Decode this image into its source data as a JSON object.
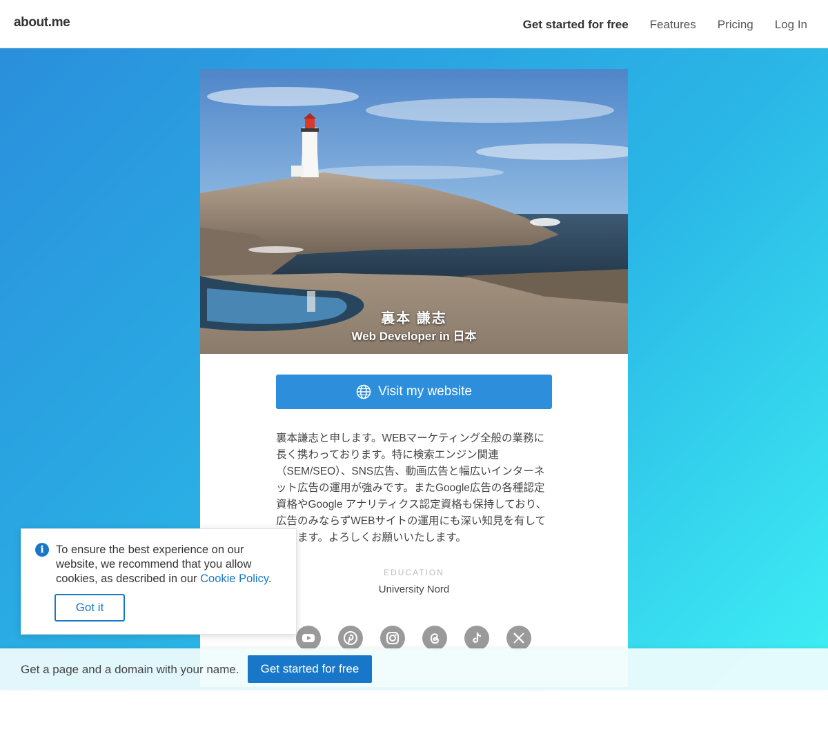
{
  "header": {
    "brand": "about.me",
    "nav": {
      "get_started": "Get started for free",
      "features": "Features",
      "pricing": "Pricing",
      "login": "Log In"
    }
  },
  "profile": {
    "name": "裏本 謙志",
    "headline": "Web Developer in 日本",
    "cover_image": "lighthouse-on-rocky-coast",
    "visit_button": "Visit my website",
    "bio": "裏本謙志と申します。WEBマーケティング全般の業務に長く携わっております。特に検索エンジン関連（SEM/SEO）、SNS広告、動画広告と幅広いインターネット広告の運用が強みです。またGoogle広告の各種認定資格やGoogle アナリティクス認定資格も保持しており、広告のみならずWEBサイトの運用にも深い知見を有しております。よろしくお願いいたします。",
    "education_label": "EDUCATION",
    "education_value": "University Nord",
    "socials": [
      "youtube-icon",
      "pinterest-icon",
      "instagram-icon",
      "threads-icon",
      "tiktok-icon",
      "x-icon"
    ]
  },
  "banner": {
    "text": "Get a page and a domain with your name.",
    "button": "Get started for free"
  },
  "cookie": {
    "text_before": "To ensure the best experience on our website, we recommend that you allow cookies, as described in our ",
    "link": "Cookie Policy",
    "text_after": ".",
    "button": "Got it"
  },
  "colors": {
    "accent": "#2d8fdc",
    "brand_blue": "#1877c9",
    "gradient_start": "#2a8fdc",
    "gradient_end": "#3ff0f4"
  }
}
